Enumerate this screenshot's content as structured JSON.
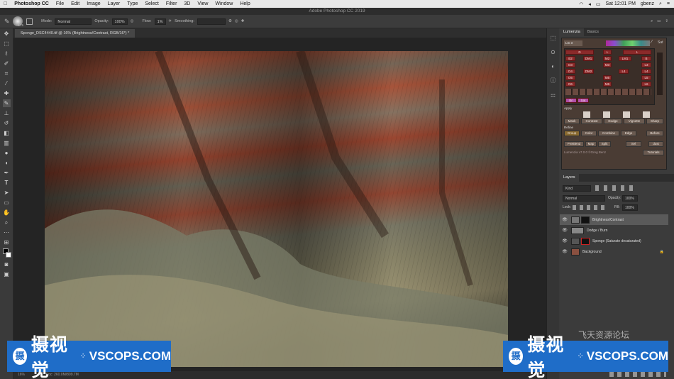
{
  "menubar": {
    "app": "Photoshop CC",
    "items": [
      "File",
      "Edit",
      "Image",
      "Layer",
      "Type",
      "Select",
      "Filter",
      "3D",
      "View",
      "Window",
      "Help"
    ],
    "clock": "Sat 12:01 PM",
    "user": "gbenz"
  },
  "window_title": "Adobe Photoshop CC 2019",
  "options": {
    "brush_size": "175",
    "mode_label": "Mode:",
    "mode_value": "Normal",
    "opacity_label": "Opacity:",
    "opacity_value": "100%",
    "flow_label": "Flow:",
    "flow_value": "1%",
    "smoothing_label": "Smoothing:"
  },
  "document_tab": "Sponge_DSC4440.tif @ 16% (Brightness/Contrast, RGB/16*) *",
  "status": {
    "zoom": "16%",
    "doc": "Doc: 260.0M/809.7M"
  },
  "lumenzia": {
    "tabs": [
      "Lumenzia",
      "Basics"
    ],
    "preset": "Lm 3",
    "sat_label": "Sat",
    "rows": [
      [
        "D",
        "L",
        "L"
      ],
      [
        "B2",
        "DM1",
        "M2",
        "LM1",
        "B"
      ],
      [
        "D3",
        "M3",
        "L3"
      ],
      [
        "D4",
        "DM2",
        "L4",
        "L4"
      ],
      [
        "D5",
        "M5",
        "L5"
      ],
      [
        "D6",
        "M6",
        "L6"
      ]
    ],
    "bottom_row": [
      "Bri",
      "Sat"
    ],
    "apply_label": "Apply",
    "apply_buttons": [
      "Mask",
      "Contrast",
      "Dodge",
      "Vignette",
      "Sharp"
    ],
    "refine_label": "Refine",
    "refine_buttons": [
      "Group",
      "Color",
      "Combine",
      "Edge",
      "Before"
    ],
    "misc_buttons": [
      "PreBlend",
      "Map",
      "Split",
      "Sel",
      "dust"
    ],
    "footer": "Lumenzia v7.0.0 ©Greg Benz",
    "tutorials": "Tutorials"
  },
  "layers": {
    "tab": "Layers",
    "kind_label": "Kind",
    "blend_mode": "Normal",
    "opacity_label": "Opacity:",
    "opacity_value": "100%",
    "lock_label": "Lock:",
    "fill_label": "Fill:",
    "fill_value": "100%",
    "items": [
      {
        "name": "Brightness/Contrast",
        "selected": true
      },
      {
        "name": "Dodge / Burn",
        "selected": false
      },
      {
        "name": "Sponge (Saturate desaturated)",
        "selected": false
      },
      {
        "name": "Background",
        "selected": false
      }
    ]
  },
  "watermark": {
    "logo_char": "摄",
    "cn": "摄视觉",
    "en": "VSCOPS.COM",
    "forum": "飞天资源论坛"
  },
  "colors": {
    "accent_blue": "#1f6dc8",
    "lumenzia_red": "#8b2a2a"
  }
}
